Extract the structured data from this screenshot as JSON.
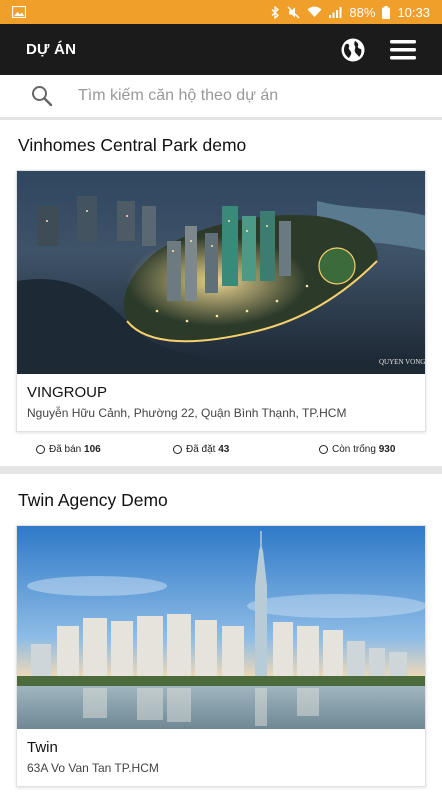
{
  "status_bar": {
    "battery": "88%",
    "time": "10:33"
  },
  "app_bar": {
    "title": "DỰ ÁN",
    "globe_icon": "globe-icon",
    "menu_icon": "hamburger-menu-icon"
  },
  "search": {
    "placeholder": "Tìm kiếm căn hộ theo dự án",
    "icon": "search-icon"
  },
  "projects": [
    {
      "title": "Vinhomes Central Park demo",
      "developer": "VINGROUP",
      "address": "Nguyễn Hữu Cảnh, Phường 22, Quận Bình Thạnh, TP.HCM",
      "image_caption": "QUYEN VONG",
      "stats": {
        "sold_label": "Đã bán",
        "sold": "106",
        "booked_label": "Đã đặt",
        "booked": "43",
        "available_label": "Còn trống",
        "available": "930"
      }
    },
    {
      "title": "Twin Agency Demo",
      "developer": "Twin",
      "address": "63A Vo Van Tan TP.HCM"
    }
  ],
  "colors": {
    "status_bar": "#f0a02a",
    "app_bar": "#1b1b1b"
  }
}
